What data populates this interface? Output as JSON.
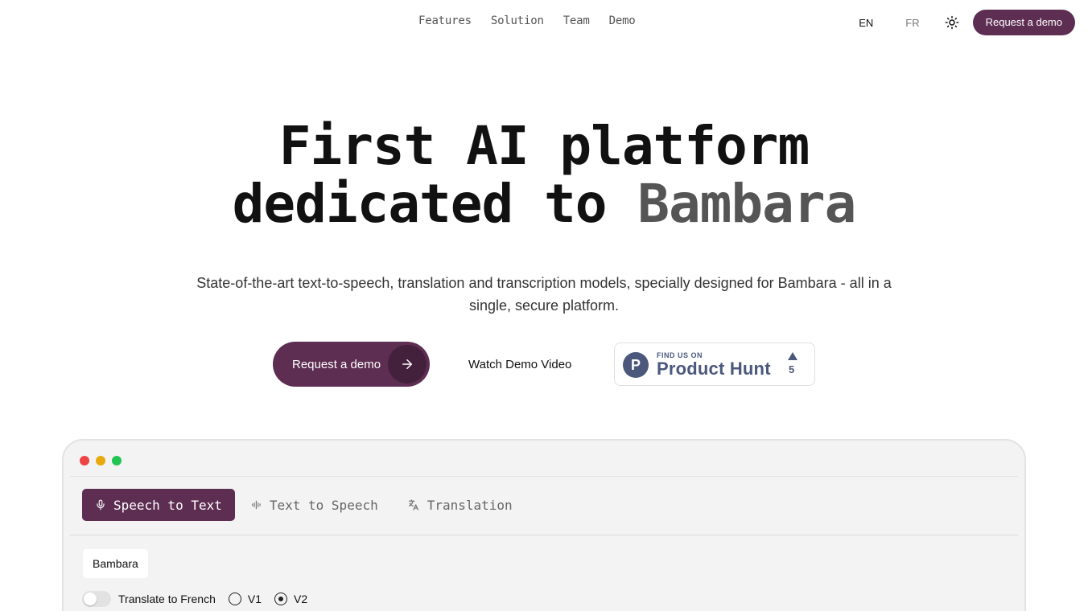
{
  "nav": {
    "links": [
      "Features",
      "Solution",
      "Team",
      "Demo"
    ],
    "lang_en": "EN",
    "lang_fr": "FR",
    "theme_icon": "sun-icon",
    "demo_label": "Request a demo"
  },
  "hero": {
    "title_line1": "First AI platform",
    "title_line2_a": "dedicated to ",
    "title_line2_b": "Bambara",
    "subtitle": "State-of-the-art text-to-speech, translation and transcription models, specially designed for Bambara - all in a single, secure platform."
  },
  "cta": {
    "primary_label": "Request a demo",
    "primary_icon": "arrow-right-icon",
    "watch_label": "Watch Demo Video",
    "product_hunt": {
      "small": "FIND US ON",
      "big": "Product Hunt",
      "logo": "P",
      "count": "5"
    }
  },
  "demo_window": {
    "tabs": [
      {
        "label": "Speech to Text",
        "icon": "microphone-icon",
        "active": true
      },
      {
        "label": "Text to Speech",
        "icon": "waveform-icon",
        "active": false
      },
      {
        "label": "Translation",
        "icon": "translate-icon",
        "active": false
      }
    ],
    "language_chip": "Bambara",
    "translate_toggle_label": "Translate to French",
    "translate_toggle_on": false,
    "versions": [
      {
        "label": "V1",
        "selected": false
      },
      {
        "label": "V2",
        "selected": true
      }
    ]
  },
  "colors": {
    "brand": "#5e2d52",
    "brand_dark": "#43203b",
    "product_hunt": "#4b587c"
  }
}
